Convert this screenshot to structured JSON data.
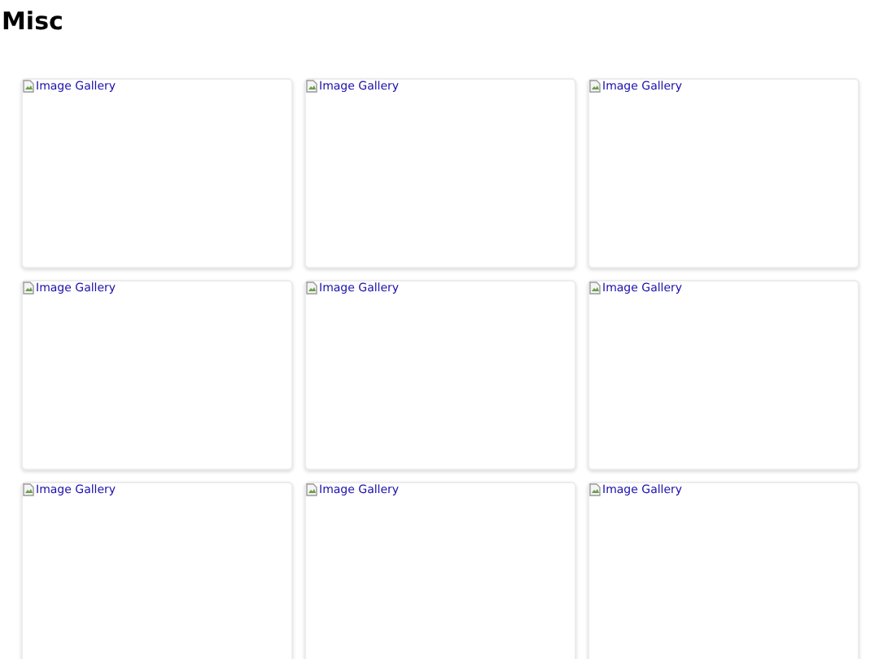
{
  "title": "Misc",
  "gallery": [
    {
      "alt": "Image Gallery"
    },
    {
      "alt": "Image Gallery"
    },
    {
      "alt": "Image Gallery"
    },
    {
      "alt": "Image Gallery"
    },
    {
      "alt": "Image Gallery"
    },
    {
      "alt": "Image Gallery"
    },
    {
      "alt": "Image Gallery"
    },
    {
      "alt": "Image Gallery"
    },
    {
      "alt": "Image Gallery"
    }
  ]
}
